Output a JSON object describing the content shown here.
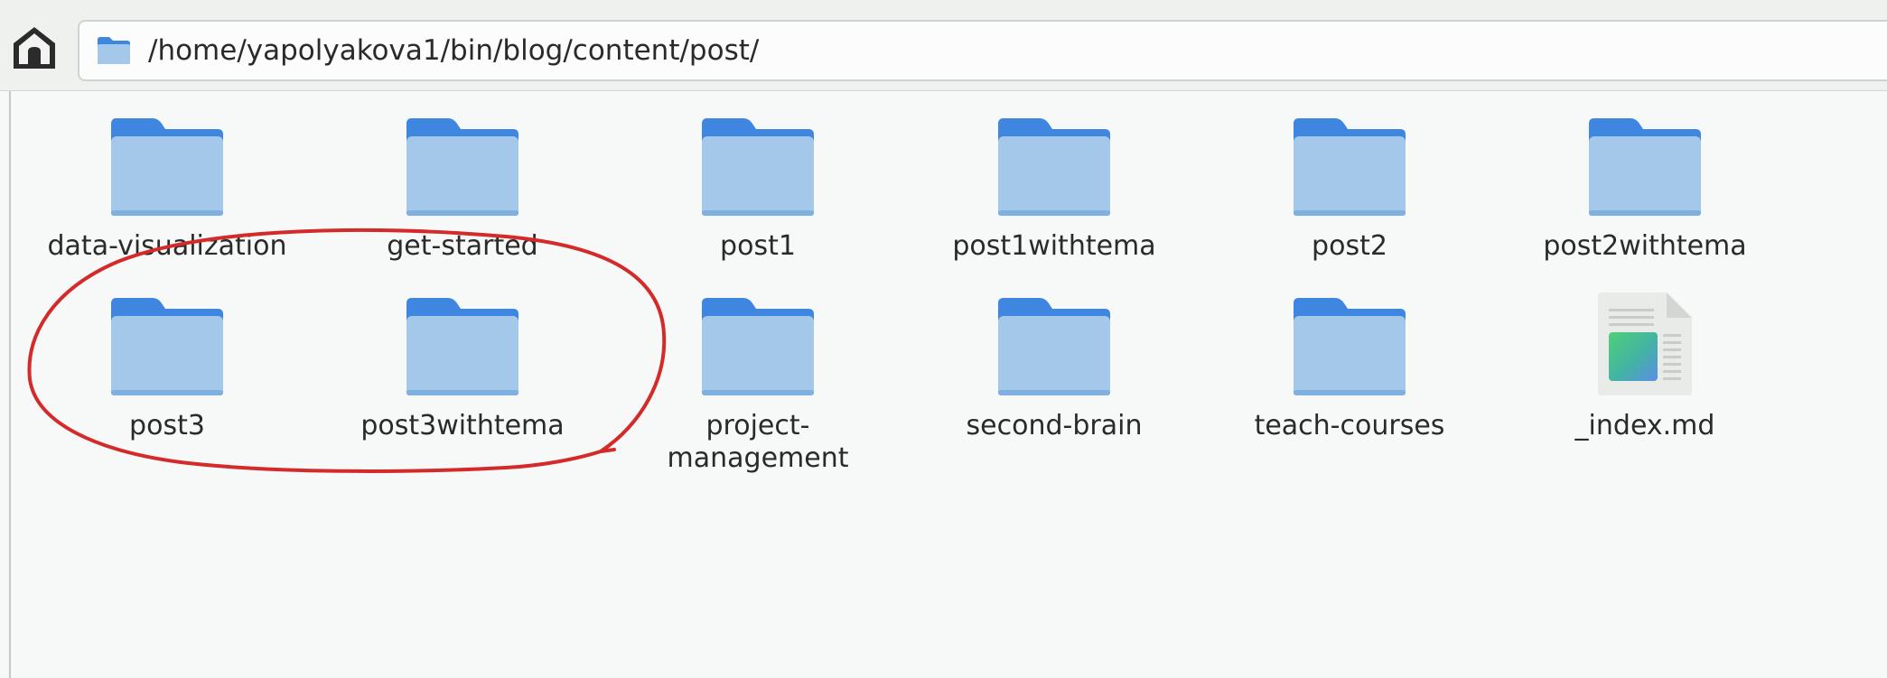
{
  "address_bar": {
    "path": "/home/yapolyakova1/bin/blog/content/post/"
  },
  "items": [
    {
      "name": "data-visualization",
      "type": "folder"
    },
    {
      "name": "get-started",
      "type": "folder"
    },
    {
      "name": "post1",
      "type": "folder"
    },
    {
      "name": "post1withtema",
      "type": "folder"
    },
    {
      "name": "post2",
      "type": "folder"
    },
    {
      "name": "post2withtema",
      "type": "folder"
    },
    {
      "name": "post3",
      "type": "folder"
    },
    {
      "name": "post3withtema",
      "type": "folder"
    },
    {
      "name": "project-\nmanagement",
      "type": "folder"
    },
    {
      "name": "second-brain",
      "type": "folder"
    },
    {
      "name": "teach-courses",
      "type": "folder"
    },
    {
      "name": "_index.md",
      "type": "file"
    }
  ],
  "colors": {
    "folder_back": "#3e86e0",
    "folder_front": "#a3c8ea",
    "annotation": "#d42a2a"
  },
  "icons": {
    "home": "home-icon",
    "folder": "folder-icon",
    "file": "markdown-file-icon"
  }
}
